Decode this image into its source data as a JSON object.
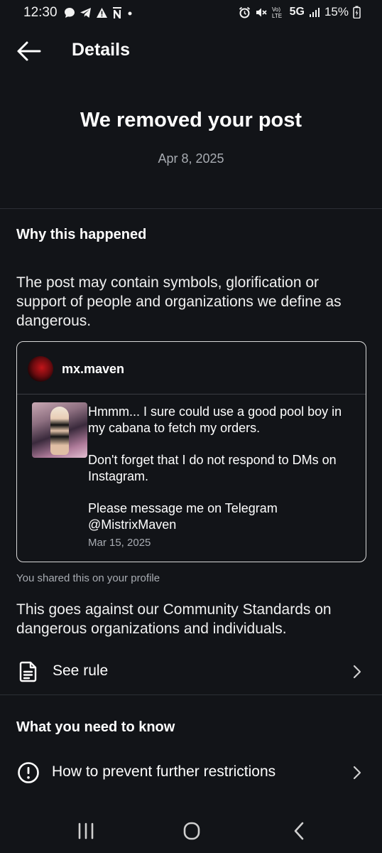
{
  "status_bar": {
    "time": "12:30",
    "network": "5G",
    "battery": "15%",
    "left_icons": [
      "chat-bubble-icon",
      "telegram-icon",
      "warning-icon",
      "n-icon",
      "dot-icon"
    ],
    "right_icons": [
      "alarm-icon",
      "mute-icon",
      "volte-icon",
      "signal-icon",
      "battery-icon"
    ]
  },
  "header": {
    "title": "Details"
  },
  "notice": {
    "title": "We removed your post",
    "date": "Apr 8, 2025"
  },
  "why": {
    "heading": "Why this happened",
    "description": "The post may contain symbols, glorification or support of people and organizations we define as dangerous."
  },
  "post": {
    "username": "mx.maven",
    "paragraphs": [
      "Hmmm... I sure could use a good pool boy in my cabana to fetch my orders.",
      "Don't forget that I do not respond to DMs on Instagram.",
      "Please message me on Telegram @MistrixMaven"
    ],
    "date": "Mar 15, 2025"
  },
  "shared_note": "You shared this on your profile",
  "standards_text": "This goes against our Community Standards on dangerous organizations and individuals.",
  "see_rule": {
    "label": "See rule",
    "icon": "document-icon"
  },
  "need_to_know": {
    "heading": "What you need to know",
    "item_label": "How to prevent further restrictions",
    "item_icon": "info-alert-icon"
  },
  "colors": {
    "background": "#121418",
    "secondary_text": "#a8acb2",
    "divider": "#2c2f35"
  }
}
